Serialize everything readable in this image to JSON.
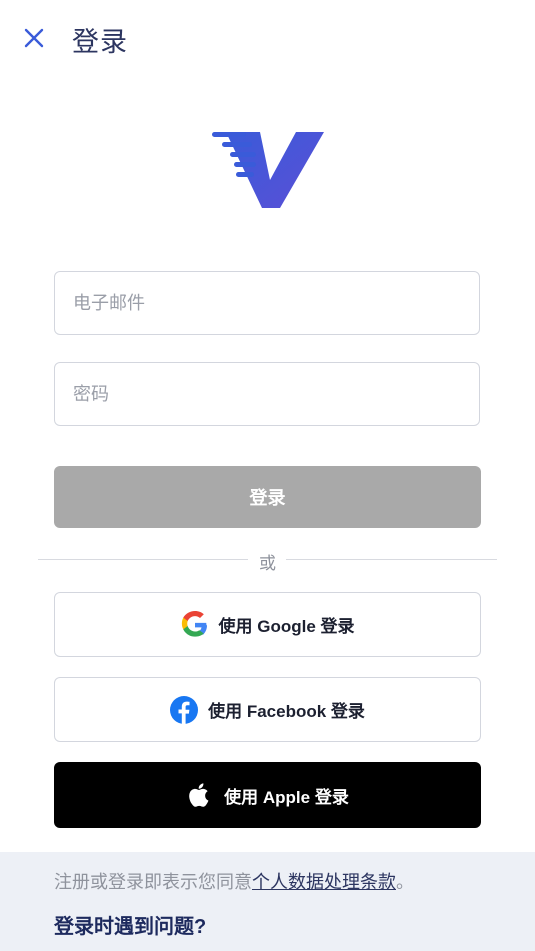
{
  "header": {
    "title": "登录",
    "close_icon": "close-icon"
  },
  "logo": {
    "icon": "v-logo-icon",
    "colors": {
      "start": "#3a5bd9",
      "end": "#5b4fd6"
    }
  },
  "form": {
    "email_placeholder": "电子邮件",
    "password_placeholder": "密码",
    "login_label": "登录"
  },
  "divider": {
    "label": "或"
  },
  "social": {
    "google_label": "使用 Google 登录",
    "facebook_label": "使用 Facebook 登录",
    "apple_label": "使用 Apple 登录"
  },
  "footer": {
    "terms_prefix": "注册或登录即表示您同意",
    "terms_link": "个人数据处理条款",
    "terms_suffix": "。",
    "help_link": "登录时遇到问题?"
  },
  "colors": {
    "accent": "#3a5bd9",
    "title": "#2c3560",
    "login_button_disabled": "#a9a9a9",
    "apple_button": "#000000",
    "footer_bg": "#edf0f6"
  }
}
